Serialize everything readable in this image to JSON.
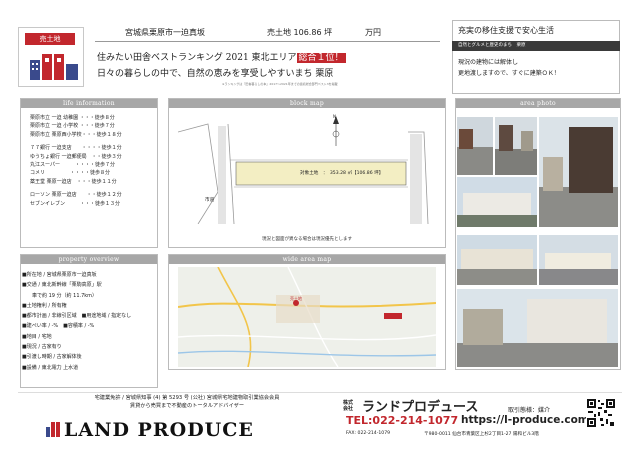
{
  "header": {
    "badge_label": "売土地",
    "location": "宮城県栗原市一迫真坂",
    "price_label": "売土地 106.86 坪",
    "price_unit": "万円",
    "catch_line_1_prefix": "住みたい田舎ベストランキング 2021 東北エリア",
    "catch_line_1_highlight": "総合１位！",
    "catch_line_2": "日々の暮らしの中で、自然の恵みを享受しやすいまち 栗原",
    "catch_note": "※ランキングは『田舎暮らしの本』2017～2021年までの連続総合部門ベスト3を掲載"
  },
  "support": {
    "title": "充実の移住支援で安心生活",
    "subtitle": "自然とグルメと歴史のまち　栗原",
    "body_line_1": "現況の建物には解体し",
    "body_line_2": "更地渡しますので、すぐに建築ＯＫ！"
  },
  "life_info": {
    "heading": "life information",
    "items": [
      "栗原市立 一迫 幼稚園 ・・・徒歩８分",
      "栗原市立 一迫 小学校 ・・・徒歩７分",
      "栗原市立 栗原西小学校・・・徒歩１８分",
      "",
      "７７銀行 一迫支店　　・・・・徒歩１分",
      "ゆうちょ銀行 一迫郵便局　・・徒歩３分",
      "丸江スーパー　　　・・・・徒歩７分",
      "コメリ　　　　　・・・・徒歩８分",
      "薬王堂 栗原一迫店　・・・徒歩１１分",
      "",
      "ローソン 栗原一迫店　　・・徒歩１２分",
      "セブンイレブン　　　・・・徒歩１３分"
    ]
  },
  "block_map": {
    "heading": "block map",
    "north_label": "N",
    "road_label": "市道",
    "lot_label": "対象土地　：　353.28 ㎡【106.86 坪】",
    "note": "現況と図面が異なる場合は現況優先とします"
  },
  "area_photo": {
    "heading": "area photo"
  },
  "property": {
    "heading": "property overview",
    "rows": [
      "■所在地 / 宮城県栗原市一迫真坂",
      "■交通 / 東北新幹線「栗駒高原」駅",
      "　　車で約 19 分（約 11.7km）",
      "■土地権利 / 所有権",
      "■都市計画 / 非線引区域　■用途地域 / 指定なし",
      "■建ぺい率 / -%　■容積率 / -%",
      "■地目 / 宅地",
      "■現況 / 古家有り",
      "■引渡し時期 / 古家解体後",
      "■設備 / 東北電力 上水道"
    ]
  },
  "wide_map": {
    "heading": "wide area map",
    "pin_label": "売土地"
  },
  "footer": {
    "license_line_1": "宅建業免許 / 宮城県知事 (4) 第 5293 号 (公社) 宮城県宅地建物取引業協会会員",
    "license_line_2": "賃貸から売買まで不動産のトータルアドバイザー",
    "brand": "LAND PRODUCE",
    "company_label_1": "株式",
    "company_label_2": "会社",
    "company_name": "ランドプロデュース",
    "deal_type": "取引態様：媒介",
    "tel": "TEL:022-214-1077",
    "url": "https://l-produce.com/",
    "fax": "FAX: 022-214-1079",
    "address": "〒980-0011 仙台市青葉区上杉2丁目1-27 陽和ビル3階"
  },
  "colors": {
    "accent_red": "#c2272d",
    "panel_gray": "#a7a7a7",
    "lot_yellow": "#f3eec3"
  }
}
